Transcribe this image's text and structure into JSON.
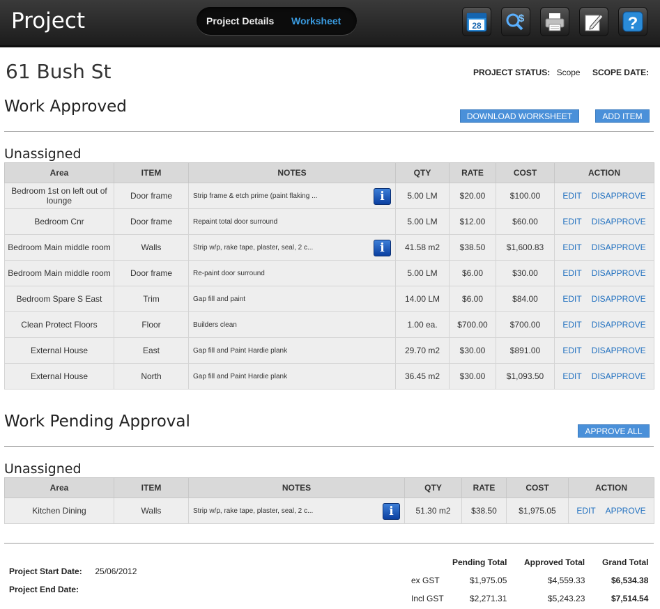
{
  "header": {
    "app_title": "Project",
    "tabs": [
      {
        "label": "Project Details"
      },
      {
        "label": "Worksheet"
      }
    ],
    "tools": [
      "calendar-icon",
      "search-cost-icon",
      "print-icon",
      "edit-icon",
      "help-icon"
    ],
    "calendar_day": "28",
    "help_glyph": "?"
  },
  "project": {
    "address": "61 Bush St",
    "status_label": "PROJECT STATUS:",
    "status_value": "Scope",
    "scope_date_label": "SCOPE DATE:"
  },
  "approved": {
    "title": "Work Approved",
    "download_label": "DOWNLOAD WORKSHEET",
    "add_label": "ADD ITEM",
    "group_title": "Unassigned",
    "columns": [
      "Area",
      "ITEM",
      "NOTES",
      "QTY",
      "RATE",
      "COST",
      "ACTION"
    ],
    "edit_label": "EDIT",
    "disapprove_label": "DISAPPROVE",
    "rows": [
      {
        "area": "Bedroom 1st on left out of lounge",
        "item": "Door frame",
        "notes": "Strip frame & etch prime (paint flaking ...",
        "qty": "5.00 LM",
        "rate": "$20.00",
        "cost": "$100.00",
        "info": true
      },
      {
        "area": "Bedroom Cnr",
        "item": "Door frame",
        "notes": "Repaint total door surround",
        "qty": "5.00 LM",
        "rate": "$12.00",
        "cost": "$60.00",
        "info": false
      },
      {
        "area": "Bedroom Main middle room",
        "item": "Walls",
        "notes": "Strip w/p, rake tape, plaster, seal, 2 c...",
        "qty": "41.58 m2",
        "rate": "$38.50",
        "cost": "$1,600.83",
        "info": true
      },
      {
        "area": "Bedroom Main middle room",
        "item": "Door frame",
        "notes": "Re-paint door surround",
        "qty": "5.00 LM",
        "rate": "$6.00",
        "cost": "$30.00",
        "info": false
      },
      {
        "area": "Bedroom Spare S East",
        "item": "Trim",
        "notes": "Gap fill and paint",
        "qty": "14.00 LM",
        "rate": "$6.00",
        "cost": "$84.00",
        "info": false
      },
      {
        "area": "Clean Protect Floors",
        "item": "Floor",
        "notes": "Builders clean",
        "qty": "1.00 ea.",
        "rate": "$700.00",
        "cost": "$700.00",
        "info": false
      },
      {
        "area": "External House",
        "item": "East",
        "notes": "Gap fill and Paint Hardie plank",
        "qty": "29.70 m2",
        "rate": "$30.00",
        "cost": "$891.00",
        "info": false
      },
      {
        "area": "External House",
        "item": "North",
        "notes": "Gap fill and Paint Hardie plank",
        "qty": "36.45 m2",
        "rate": "$30.00",
        "cost": "$1,093.50",
        "info": false
      }
    ]
  },
  "pending": {
    "title": "Work Pending Approval",
    "approve_all_label": "APPROVE ALL",
    "group_title": "Unassigned",
    "columns": [
      "Area",
      "ITEM",
      "NOTES",
      "QTY",
      "RATE",
      "COST",
      "ACTION"
    ],
    "edit_label": "EDIT",
    "approve_label": "APPROVE",
    "rows": [
      {
        "area": "Kitchen Dining",
        "item": "Walls",
        "notes": "Strip w/p, rake tape, plaster, seal, 2 c...",
        "qty": "51.30 m2",
        "rate": "$38.50",
        "cost": "$1,975.05",
        "info": true
      }
    ]
  },
  "summary": {
    "start_label": "Project Start Date:",
    "start_value": "25/06/2012",
    "end_label": "Project End Date:",
    "end_value": "",
    "pending_total_label": "Pending Total",
    "approved_total_label": "Approved Total",
    "grand_total_label": "Grand Total",
    "ex_gst_label": "ex GST",
    "incl_gst_label": "Incl GST",
    "ex_gst": {
      "pending": "$1,975.05",
      "approved": "$4,559.33",
      "grand": "$6,534.38"
    },
    "incl_gst": {
      "pending": "$2,271.31",
      "approved": "$5,243.23",
      "grand": "$7,514.54"
    }
  },
  "colors": {
    "accent": "#4a90d9",
    "link": "#1f6fbf",
    "active_tab": "#3a9be0",
    "header_bg": "#2a2a2a"
  }
}
